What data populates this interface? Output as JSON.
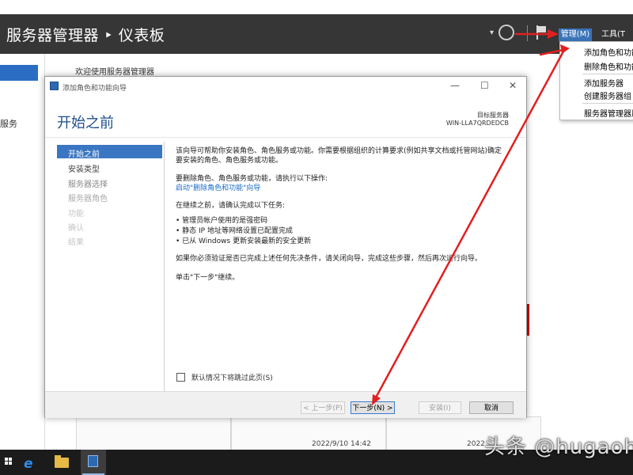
{
  "header": {
    "title": "服务器管理器 ‣ 仪表板",
    "manage_label": "管理(M)",
    "tools_label": "工具(T"
  },
  "sidebar": {
    "items": [
      "服务"
    ]
  },
  "dashboard": {
    "welcome": "欢迎使用服务器管理器",
    "dates": [
      "2022/9/10 14:42",
      "2022"
    ]
  },
  "manage_menu": {
    "items": [
      "添加角色和功能",
      "删除角色和功能",
      "添加服务器",
      "创建服务器组",
      "服务器管理器属"
    ]
  },
  "wizard": {
    "window_title": "添加角色和功能向导",
    "heading": "开始之前",
    "destination_label": "目标服务器",
    "destination_server": "WIN-LLA7QRDEDCB",
    "nav": [
      "开始之前",
      "安装类型",
      "服务器选择",
      "服务器角色",
      "功能",
      "确认",
      "结果"
    ],
    "content": {
      "intro_line1": "该向导可帮助你安装角色、角色服务或功能。你需要根据组织的计算要求(例如共享文档或托管网站)确定",
      "intro_line2": "要安装的角色、角色服务或功能。",
      "remove_text": "要删除角色、角色服务或功能，请执行以下操作:",
      "remove_link": "启动\"删除角色和功能\"向导",
      "before_text": "在继续之前，请确认完成以下任务:",
      "tasks": [
        "• 管理员帐户使用的是强密码",
        "• 静态 IP 地址等网络设置已配置完成",
        "• 已从 Windows 更新安装最新的安全更新"
      ],
      "verify_text": "如果你必须验证是否已完成上述任何先决条件，请关闭向导，完成这些步骤，然后再次运行向导。",
      "click_next": "单击\"下一步\"继续。"
    },
    "skip_checkbox": "默认情况下将跳过此页(S)",
    "buttons": {
      "prev": "< 上一步(P)",
      "next": "下一步(N) >",
      "install": "安装(I)",
      "cancel": "取消"
    }
  },
  "watermark": "头条 @hugaoha"
}
